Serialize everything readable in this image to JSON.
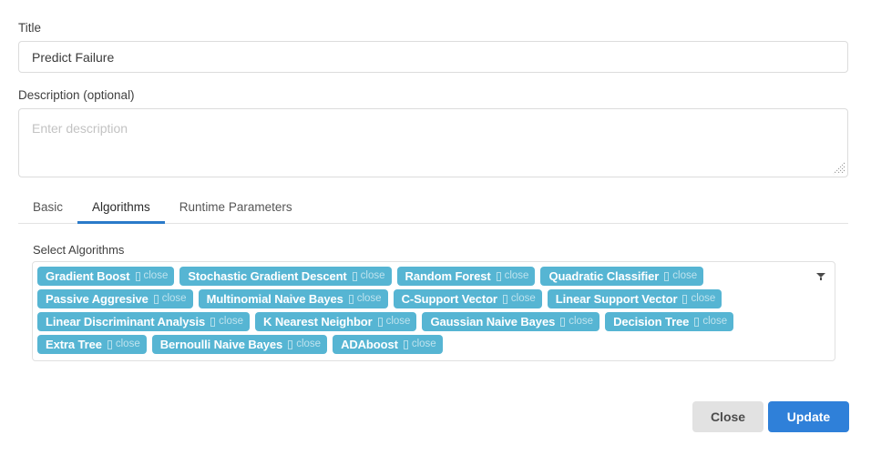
{
  "form": {
    "title_label": "Title",
    "title_value": "Predict Failure",
    "description_label": "Description (optional)",
    "description_value": "",
    "description_placeholder": "Enter description"
  },
  "tabs": [
    {
      "label": "Basic",
      "active": false
    },
    {
      "label": "Algorithms",
      "active": true
    },
    {
      "label": "Runtime Parameters",
      "active": false
    }
  ],
  "algorithms_panel": {
    "select_label": "Select Algorithms",
    "close_word": "close",
    "caret_icon": "chevron-down-icon",
    "tags": [
      {
        "label": "Gradient Boost"
      },
      {
        "label": "Stochastic Gradient Descent"
      },
      {
        "label": "Random Forest"
      },
      {
        "label": "Quadratic Classifier"
      },
      {
        "label": "Passive Aggresive"
      },
      {
        "label": "Multinomial Naive Bayes"
      },
      {
        "label": "C-Support Vector"
      },
      {
        "label": "Linear Support Vector"
      },
      {
        "label": "Linear Discriminant Analysis"
      },
      {
        "label": "K Nearest Neighbor"
      },
      {
        "label": "Gaussian Naive Bayes"
      },
      {
        "label": "Decision Tree"
      },
      {
        "label": "Extra Tree"
      },
      {
        "label": "Bernoulli Naive Bayes"
      },
      {
        "label": "ADAboost"
      }
    ]
  },
  "footer": {
    "close_label": "Close",
    "update_label": "Update"
  },
  "colors": {
    "tag_background": "#56b5d3",
    "primary_button": "#2f80d9",
    "secondary_button": "#e2e2e2",
    "active_tab_underline": "#2a7ac9"
  }
}
